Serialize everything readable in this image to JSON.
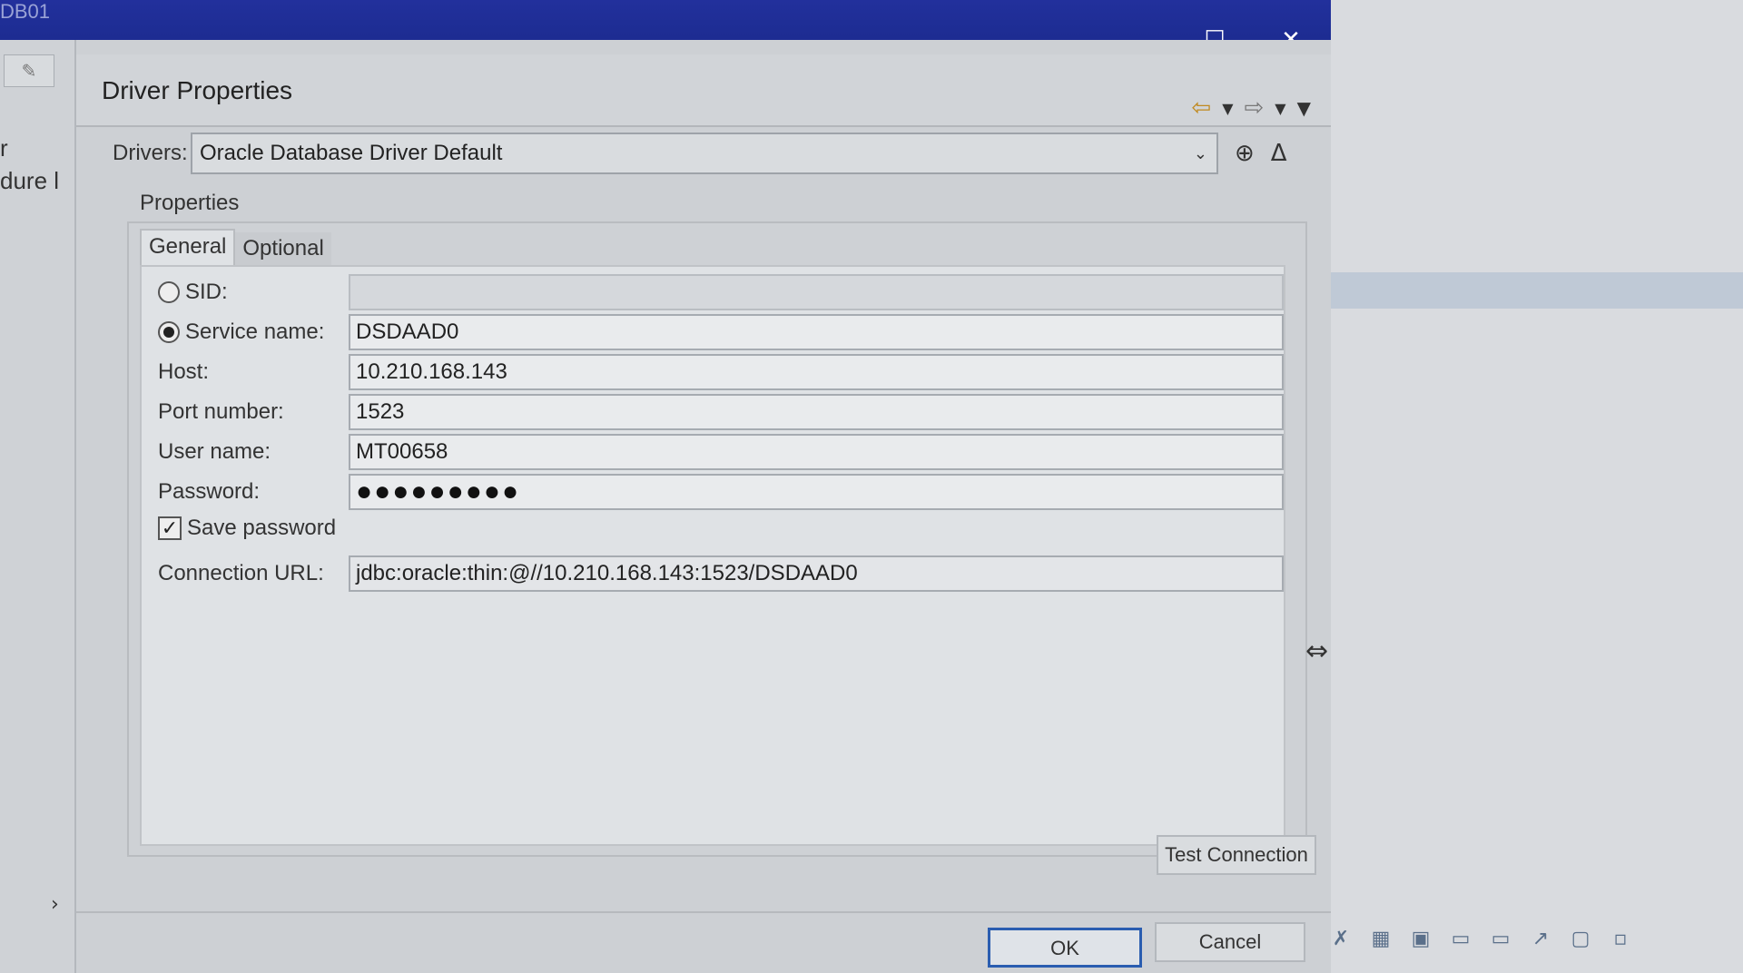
{
  "window": {
    "titlebar_fragment": "DB01",
    "maximize_icon": "maximize-icon",
    "close_icon": "close-icon"
  },
  "left_panel": {
    "text_fragment_1": "r",
    "text_fragment_2": "dure l",
    "chevron": "›"
  },
  "header": {
    "title": "Driver Properties",
    "back_icon": "back-arrow-icon",
    "forward_icon": "forward-arrow-icon",
    "menu_icon": "view-menu-icon"
  },
  "drivers": {
    "label": "Drivers:",
    "selected": "Oracle Database Driver Default"
  },
  "properties": {
    "label": "Properties",
    "tabs": [
      {
        "label": "General",
        "active": true
      },
      {
        "label": "Optional",
        "active": false
      }
    ]
  },
  "fields": {
    "sid": {
      "label": "SID:",
      "value": ""
    },
    "service_name": {
      "label": "Service name:",
      "value": "DSDAAD0"
    },
    "host": {
      "label": "Host:",
      "value": "10.210.168.143"
    },
    "port": {
      "label": "Port number:",
      "value": "1523"
    },
    "user": {
      "label": "User name:",
      "value": "MT00658"
    },
    "password": {
      "label": "Password:",
      "value": "●●●●●●●●●"
    },
    "save_password": {
      "label": "Save password",
      "checked": true
    },
    "connection_url": {
      "label": "Connection URL:",
      "value": "jdbc:oracle:thin:@//10.210.168.143:1523/DSDAAD0"
    }
  },
  "buttons": {
    "test_connection": "Test Connection",
    "ok": "OK",
    "cancel": "Cancel"
  },
  "colors": {
    "titlebar": "#1f2e96",
    "ok_border": "#2a5db0",
    "nav_arrow": "#c08a20"
  }
}
